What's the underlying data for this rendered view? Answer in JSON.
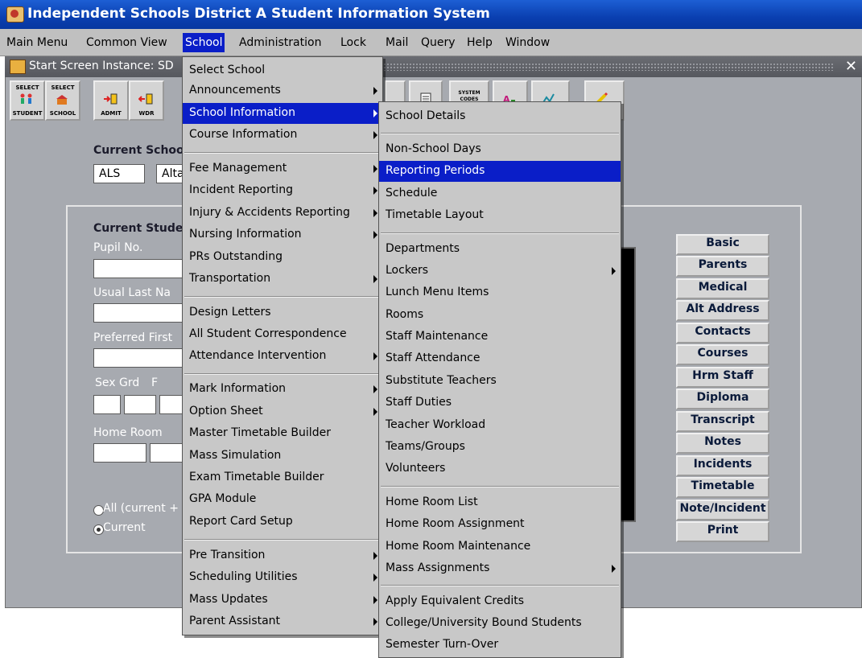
{
  "app": {
    "title": "Independent Schools District A Student Information System"
  },
  "menubar": [
    "Main Menu",
    "Common View",
    "School",
    "Administration",
    "Lock",
    "Mail",
    "Query",
    "Help",
    "Window"
  ],
  "window": {
    "title": "Start Screen  Instance: SD"
  },
  "toolbar": [
    {
      "l1": "SELECT",
      "l2": "STUDENT"
    },
    {
      "l1": "SELECT",
      "l2": "SCHOOL"
    },
    {
      "l1": "",
      "l2": "ADMIT"
    },
    {
      "l1": "",
      "l2": "WDR"
    }
  ],
  "toolbar_right_label": "SYSTEM CODES",
  "form": {
    "current_school_label": "Current Schoo",
    "school_code": "ALS",
    "school_name": "Alta",
    "current_student_label": "Current Studen",
    "pupil_no_label": "Pupil No.",
    "usual_last_label": "Usual Last Na",
    "preferred_first_label": "Preferred First",
    "sex_label": "Sex",
    "grd_label": "Grd",
    "f_label": "F",
    "home_room_label": "Home Room",
    "radio_all": "All (current +",
    "radio_current": "Current"
  },
  "right_buttons": [
    "Basic",
    "Parents",
    "Medical",
    "Alt Address",
    "Contacts",
    "Courses",
    "Hrm Staff",
    "Diploma",
    "Transcript",
    "Notes",
    "Incidents",
    "Timetable",
    "Note/Incident",
    "Print"
  ],
  "school_menu": [
    {
      "label": "Select School",
      "sub": false
    },
    {
      "label": "Announcements",
      "sub": true
    },
    {
      "label": "School Information",
      "sub": true,
      "highlight": true
    },
    {
      "label": "Course Information",
      "sub": true
    },
    {
      "label": "Fee Management",
      "sub": true
    },
    {
      "label": "Incident Reporting",
      "sub": true
    },
    {
      "label": "Injury & Accidents Reporting",
      "sub": true
    },
    {
      "label": "Nursing Information",
      "sub": true
    },
    {
      "label": "PRs Outstanding",
      "sub": false
    },
    {
      "label": "Transportation",
      "sub": true
    },
    {
      "label": "Design Letters",
      "sub": false
    },
    {
      "label": "All Student Correspondence",
      "sub": false
    },
    {
      "label": "Attendance Intervention",
      "sub": true
    },
    {
      "label": "Mark Information",
      "sub": true
    },
    {
      "label": "Option Sheet",
      "sub": true
    },
    {
      "label": "Master Timetable Builder",
      "sub": false
    },
    {
      "label": "Mass Simulation",
      "sub": false
    },
    {
      "label": "Exam Timetable Builder",
      "sub": false
    },
    {
      "label": "GPA Module",
      "sub": false
    },
    {
      "label": "Report Card Setup",
      "sub": false
    },
    {
      "label": "Pre Transition",
      "sub": true
    },
    {
      "label": "Scheduling Utilities",
      "sub": true
    },
    {
      "label": "Mass Updates",
      "sub": true
    },
    {
      "label": "Parent Assistant",
      "sub": true
    }
  ],
  "submenu": [
    {
      "label": "School Details",
      "sub": false
    },
    {
      "label": "Non-School Days",
      "sub": false
    },
    {
      "label": "Reporting Periods",
      "sub": false,
      "highlight": true
    },
    {
      "label": "Schedule",
      "sub": false
    },
    {
      "label": "Timetable Layout",
      "sub": false
    },
    {
      "label": "Departments",
      "sub": false
    },
    {
      "label": "Lockers",
      "sub": true
    },
    {
      "label": "Lunch Menu Items",
      "sub": false
    },
    {
      "label": "Rooms",
      "sub": false
    },
    {
      "label": "Staff Maintenance",
      "sub": false
    },
    {
      "label": "Staff Attendance",
      "sub": false
    },
    {
      "label": "Substitute Teachers",
      "sub": false
    },
    {
      "label": "Staff Duties",
      "sub": false
    },
    {
      "label": "Teacher Workload",
      "sub": false
    },
    {
      "label": "Teams/Groups",
      "sub": false
    },
    {
      "label": "Volunteers",
      "sub": false
    },
    {
      "label": "Home Room List",
      "sub": false
    },
    {
      "label": "Home Room Assignment",
      "sub": false
    },
    {
      "label": "Home Room Maintenance",
      "sub": false
    },
    {
      "label": "Mass Assignments",
      "sub": true
    },
    {
      "label": "Apply Equivalent Credits",
      "sub": false
    },
    {
      "label": "College/University Bound Students",
      "sub": false
    },
    {
      "label": "Semester Turn-Over",
      "sub": false
    }
  ],
  "colors": {
    "highlight": "#0a1ec8",
    "titlebar": "#0a3fb0",
    "window_bg": "#a7aab0"
  }
}
